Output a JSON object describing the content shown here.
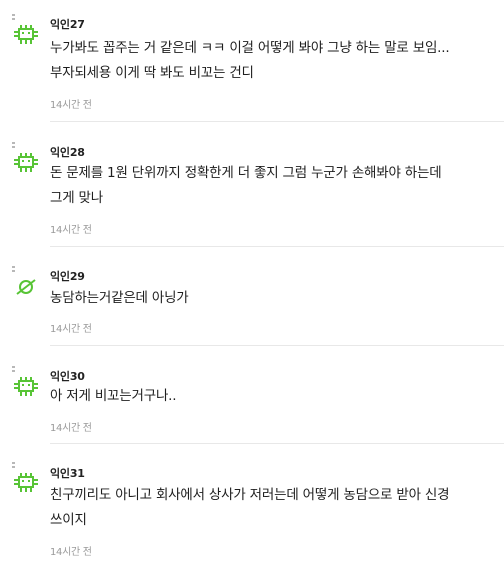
{
  "comments": [
    {
      "author": "익인27",
      "avatar_icon": "bug-icon",
      "lines": [
        "누가봐도 꼽주는 거 같은데 ㅋㅋ 이걸 어떻게 봐야 그냥 하는 말로 보임...",
        "부자되세용 이게 딱 봐도 비꼬는 건디"
      ],
      "time": "14시간 전"
    },
    {
      "author": "익인28",
      "avatar_icon": "bug-icon",
      "lines": [
        "돈 문제를 1원 단위까지 정확한게 더 좋지 그럼 누군가 손해봐야 하는데",
        "그게 맞나"
      ],
      "time": "14시간 전"
    },
    {
      "author": "익인29",
      "avatar_icon": "planet-icon",
      "lines": [
        "농담하는거같은데 아닝가"
      ],
      "time": "14시간 전"
    },
    {
      "author": "익인30",
      "avatar_icon": "bug-icon",
      "lines": [
        "아 저게 비꼬는거구나.."
      ],
      "time": "14시간 전"
    },
    {
      "author": "익인31",
      "avatar_icon": "bug-icon",
      "lines": [
        "친구끼리도 아니고 회사에서 상사가 저러는데 어떻게 농담으로 받아 신경",
        "쓰이지"
      ],
      "time": "14시간 전"
    }
  ],
  "colors": {
    "icon_green": "#58c436",
    "text": "#1e1e1e",
    "meta": "#9a9a9a",
    "divider": "#e8e8e8"
  }
}
